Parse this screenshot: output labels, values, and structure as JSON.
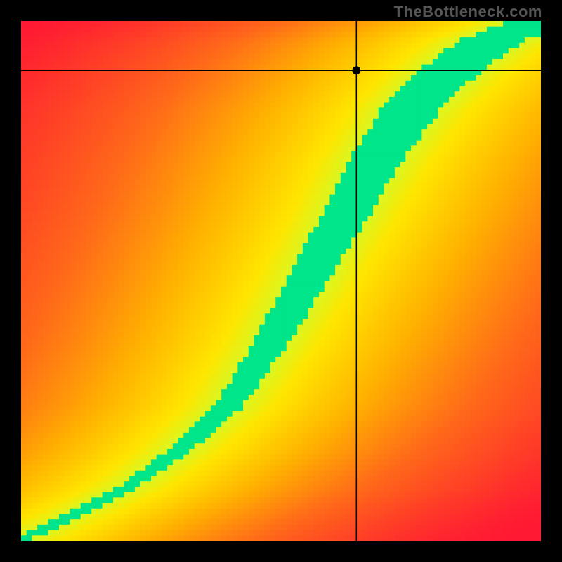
{
  "watermark": "TheBottleneck.com",
  "chart_data": {
    "type": "heatmap",
    "title": "",
    "xlabel": "",
    "ylabel": "",
    "xlim": [
      0,
      1
    ],
    "ylim": [
      0,
      1
    ],
    "crosshair": {
      "x": 0.645,
      "y": 0.905
    },
    "marker": {
      "x": 0.645,
      "y": 0.905
    },
    "optimal_curve": {
      "description": "green optimal band from bottom-left to top-right with S-shaped bend",
      "points": [
        {
          "x": 0.0,
          "y": 0.0
        },
        {
          "x": 0.1,
          "y": 0.05
        },
        {
          "x": 0.2,
          "y": 0.1
        },
        {
          "x": 0.3,
          "y": 0.17
        },
        {
          "x": 0.4,
          "y": 0.26
        },
        {
          "x": 0.48,
          "y": 0.38
        },
        {
          "x": 0.55,
          "y": 0.5
        },
        {
          "x": 0.62,
          "y": 0.62
        },
        {
          "x": 0.68,
          "y": 0.73
        },
        {
          "x": 0.75,
          "y": 0.83
        },
        {
          "x": 0.82,
          "y": 0.9
        },
        {
          "x": 0.9,
          "y": 0.96
        },
        {
          "x": 1.0,
          "y": 1.0
        }
      ],
      "band_half_width_norm_top": 0.065,
      "band_half_width_norm_bottom": 0.015
    },
    "grid_resolution": 96,
    "color_scale": {
      "0.00": "#ff1a33",
      "0.35": "#ff6a1a",
      "0.60": "#ffb300",
      "0.80": "#ffe600",
      "0.92": "#c8ff33",
      "1.00": "#00e58a"
    }
  }
}
